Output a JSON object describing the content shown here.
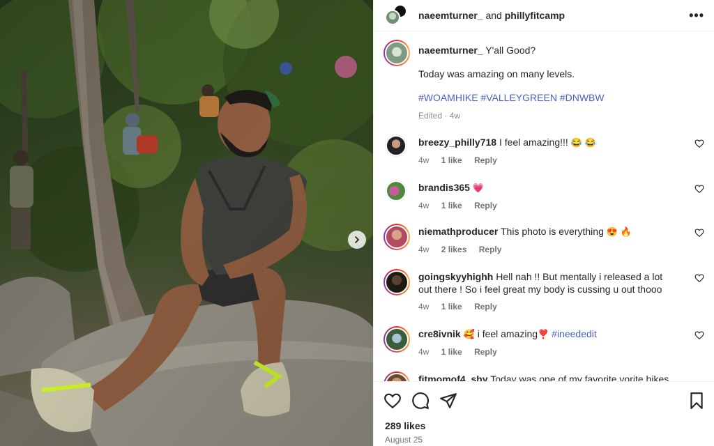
{
  "header": {
    "user1": "naeemturner_",
    "and_text": "and",
    "user2": "phillyfitcamp",
    "more": "•••"
  },
  "caption": {
    "username": "naeemturner_",
    "line1": "Y'all Good?",
    "line2": "Today was amazing on many levels.",
    "hashtags": [
      "#WOAMHIKE",
      "#VALLEYGREEN",
      "#DNWBW"
    ],
    "edited": "Edited · 4w"
  },
  "comments": [
    {
      "username": "breezy_philly718",
      "text": "I feel amazing!!!",
      "emoji": "😂 😂",
      "time": "4w",
      "likes": "1 like",
      "reply": "Reply"
    },
    {
      "username": "brandis365",
      "text": "",
      "emoji": "💗",
      "time": "4w",
      "likes": "1 like",
      "reply": "Reply"
    },
    {
      "username": "niemathproducer",
      "text": "This photo is everything",
      "emoji": "😍 🔥",
      "time": "4w",
      "likes": "2 likes",
      "reply": "Reply"
    },
    {
      "username": "goingskyyhighh",
      "text": "Hell nah !! But mentally i released a lot out there ! So i feel great my body is cussing u out thooo",
      "emoji": "",
      "time": "4w",
      "likes": "1 like",
      "reply": "Reply"
    },
    {
      "username": "cre8ivnik",
      "text_pre": "i feel amazing",
      "emoji_pre": "🥰",
      "emoji_mid": "❣️",
      "tag": "#ineededit",
      "time": "4w",
      "likes": "1 like",
      "reply": "Reply"
    },
    {
      "username": "fitmomof4_shy",
      "text": "Today was one of my favorite vorite hikes"
    }
  ],
  "footer": {
    "likes": "289 likes",
    "date": "August 25"
  },
  "colors": {
    "link": "#4a5fc1",
    "muted": "#737373",
    "text": "#262626"
  }
}
